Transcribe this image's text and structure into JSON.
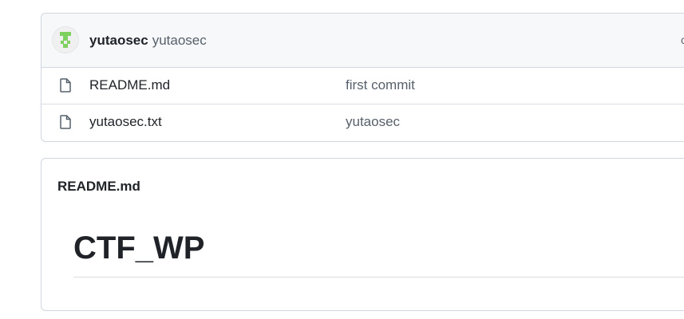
{
  "latest_commit": {
    "author": "yutaosec",
    "message": "yutaosec",
    "avatar_icon": "identicon-avatar",
    "right_text": "c"
  },
  "files": [
    {
      "name": "README.md",
      "commit_message": "first commit",
      "icon": "file-icon"
    },
    {
      "name": "yutaosec.txt",
      "commit_message": "yutaosec",
      "icon": "file-icon"
    }
  ],
  "readme": {
    "title": "README.md",
    "heading": "CTF_WP"
  },
  "colors": {
    "border": "#d0d7de",
    "header_bg": "#f6f8fa",
    "muted_text": "#57606a",
    "avatar_green": "#7ed05f"
  }
}
